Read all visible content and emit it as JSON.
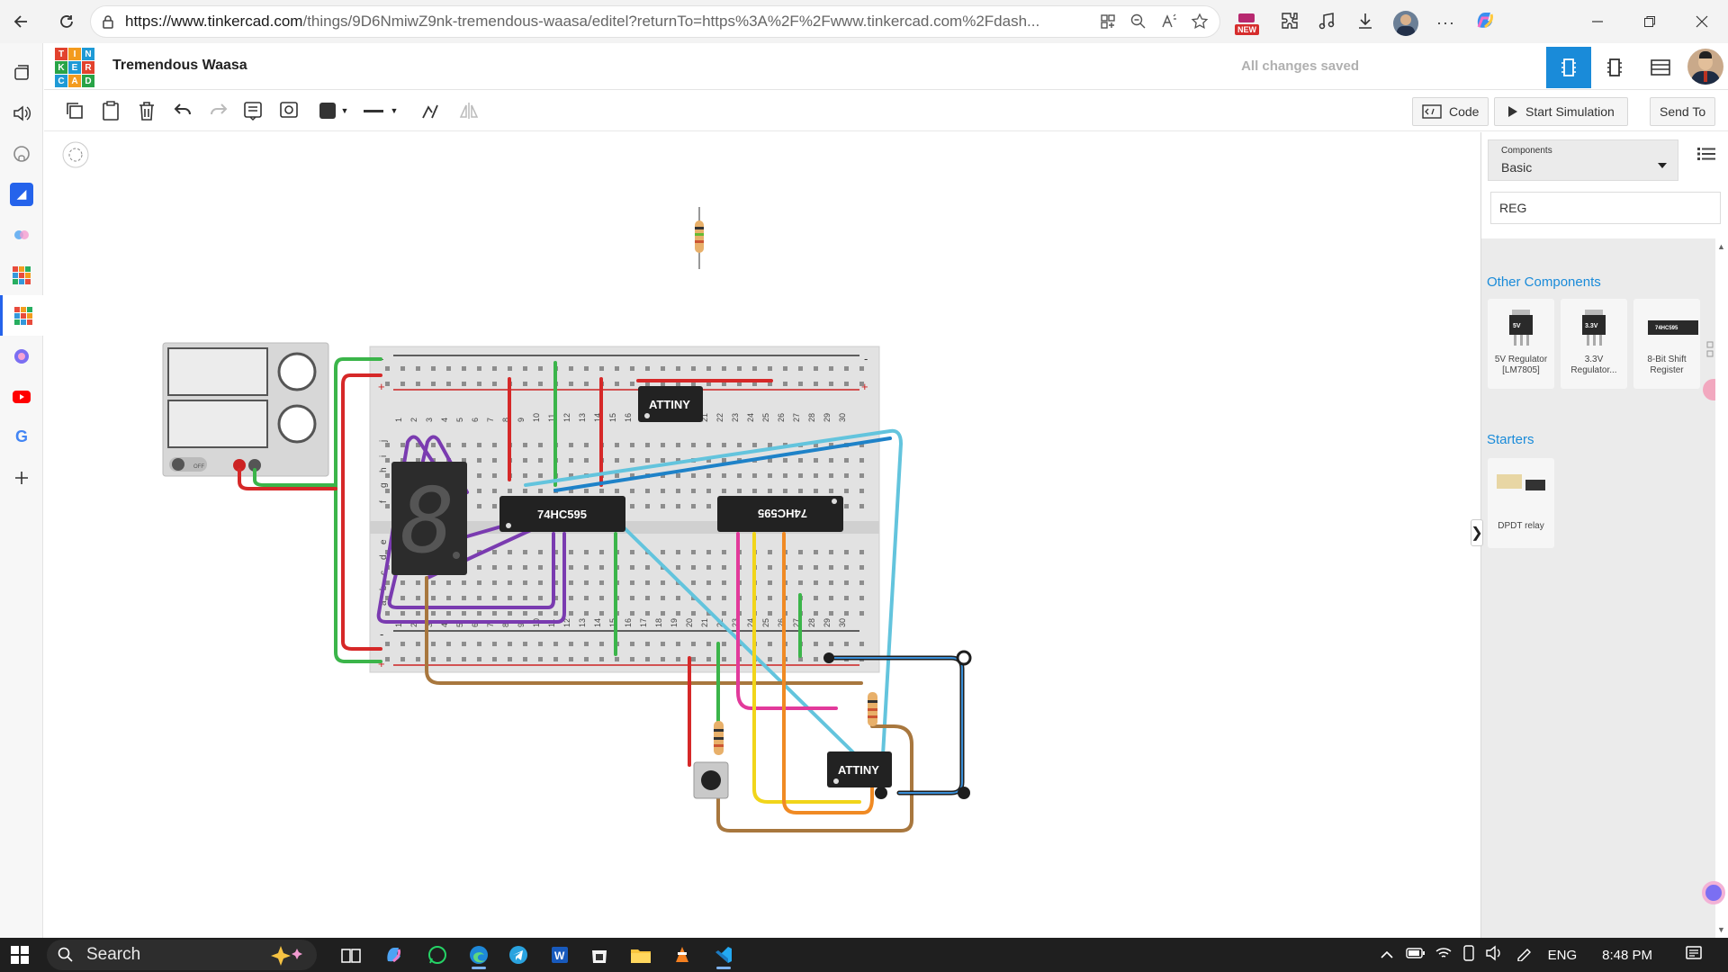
{
  "browser": {
    "url_host": "https://www.tinkercad.com",
    "url_path": "/things/9D6NmiwZ9nk-tremendous-waasa/editel?returnTo=https%3A%2F%2Fwww.tinkercad.com%2Fdash...",
    "new_badge": "NEW"
  },
  "header": {
    "logo_letters": [
      "T",
      "I",
      "N",
      "K",
      "E",
      "R",
      "C",
      "A",
      "D"
    ],
    "project_title": "Tremendous Waasa",
    "save_status": "All changes saved"
  },
  "toolbar": {
    "code_label": "Code",
    "start_simulation_label": "Start Simulation",
    "send_to_label": "Send To"
  },
  "canvas": {
    "chip_labels": {
      "attiny_top": "ATTINY",
      "shift_reg_left": "74HC595",
      "shift_reg_right": "74HC595",
      "attiny_bottom": "ATTINY"
    },
    "digit": "8",
    "breadboard_numbers": [
      "1",
      "2",
      "3",
      "4",
      "5",
      "6",
      "7",
      "8",
      "9",
      "10",
      "11",
      "12",
      "13",
      "14",
      "15",
      "16",
      "17",
      "18",
      "19",
      "20",
      "21",
      "22",
      "23",
      "24",
      "25",
      "26",
      "27",
      "28",
      "29",
      "30"
    ],
    "row_letters_top": [
      "j",
      "i",
      "h",
      "g",
      "f"
    ],
    "row_letters_bottom": [
      "e",
      "d",
      "c",
      "b",
      "a"
    ],
    "power_supply_switch": "OFF",
    "rail_minus": "-",
    "rail_plus": "+"
  },
  "panel": {
    "components_label": "Components",
    "components_value": "Basic",
    "search_value": "REG",
    "other_components_title": "Other Components",
    "components": [
      {
        "name": "5V Regulator [LM7805]",
        "thumb_text": "5V"
      },
      {
        "name": "3.3V Regulator...",
        "thumb_text": "3.3V"
      },
      {
        "name": "8-Bit Shift Register",
        "thumb_text": "74HC595"
      }
    ],
    "starters_title": "Starters",
    "starter": {
      "name": "DPDT relay"
    }
  },
  "taskbar": {
    "search_label": "Search",
    "language": "ENG",
    "time": "8:48 PM"
  },
  "colors": {
    "accent_blue": "#1a8bd9",
    "breadboard": "#e2e2e2",
    "chip": "#222222"
  }
}
